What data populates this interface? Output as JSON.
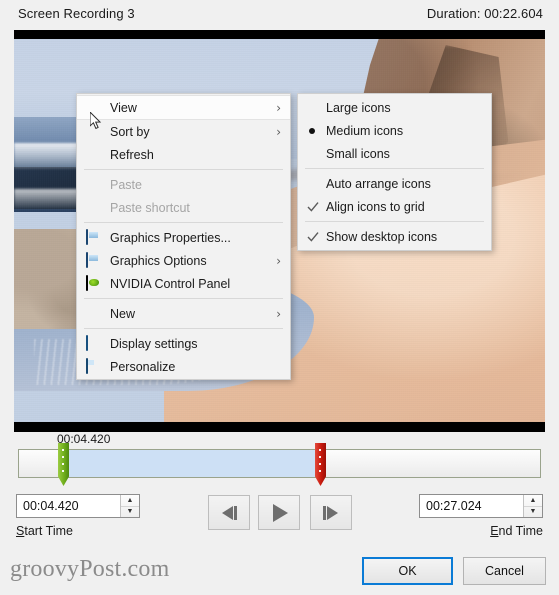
{
  "header": {
    "title": "Screen Recording 3",
    "duration": "Duration: 00:22.604"
  },
  "video": {
    "alt": "beach video frame with sand, sea and rock cliff"
  },
  "context_menu": {
    "items": [
      {
        "label": "View",
        "icon": "none",
        "submenu": true,
        "disabled": false,
        "highlighted": true
      },
      {
        "label": "Sort by",
        "icon": "none",
        "submenu": true,
        "disabled": false,
        "highlighted": false
      },
      {
        "label": "Refresh",
        "icon": "none",
        "submenu": false,
        "disabled": false,
        "highlighted": false
      },
      {
        "label": "Paste",
        "icon": "none",
        "submenu": false,
        "disabled": true,
        "highlighted": false
      },
      {
        "label": "Paste shortcut",
        "icon": "none",
        "submenu": false,
        "disabled": true,
        "highlighted": false
      },
      {
        "label": "Graphics Properties...",
        "icon": "graphics-icon",
        "submenu": false,
        "disabled": false,
        "highlighted": false
      },
      {
        "label": "Graphics Options",
        "icon": "graphics-icon",
        "submenu": true,
        "disabled": false,
        "highlighted": false
      },
      {
        "label": "NVIDIA Control Panel",
        "icon": "nvidia-icon",
        "submenu": false,
        "disabled": false,
        "highlighted": false
      },
      {
        "label": "New",
        "icon": "none",
        "submenu": true,
        "disabled": false,
        "highlighted": false
      },
      {
        "label": "Display settings",
        "icon": "display-icon",
        "submenu": false,
        "disabled": false,
        "highlighted": false
      },
      {
        "label": "Personalize",
        "icon": "personalize-icon",
        "submenu": false,
        "disabled": false,
        "highlighted": false
      }
    ]
  },
  "view_submenu": {
    "items": [
      {
        "label": "Large icons",
        "mark": "none"
      },
      {
        "label": "Medium icons",
        "mark": "radio"
      },
      {
        "label": "Small icons",
        "mark": "none"
      },
      {
        "label": "Auto arrange icons",
        "mark": "none"
      },
      {
        "label": "Align icons to grid",
        "mark": "check"
      },
      {
        "label": "Show desktop icons",
        "mark": "check"
      }
    ]
  },
  "timeline": {
    "position_label": "00:04.420",
    "selection_start": "00:04.420",
    "selection_end": "00:27.024",
    "start_handle_color": "#6fae1d",
    "end_handle_color": "#c8190d",
    "selection_color": "#cde0f5"
  },
  "controls": {
    "start_time_value": "00:04.420",
    "start_time_label": "Start Time",
    "start_time_accesskey": "S",
    "end_time_value": "00:27.024",
    "end_time_label": "End Time",
    "end_time_accesskey": "E",
    "prev_frame_icon": "previous-frame-icon",
    "play_icon": "play-icon",
    "next_frame_icon": "next-frame-icon",
    "spinner_up": "▲",
    "spinner_down": "▼"
  },
  "footer": {
    "watermark": "groovyPost.com",
    "ok_label": "OK",
    "cancel_label": "Cancel",
    "ok_focus_color": "#0a7bd6"
  }
}
